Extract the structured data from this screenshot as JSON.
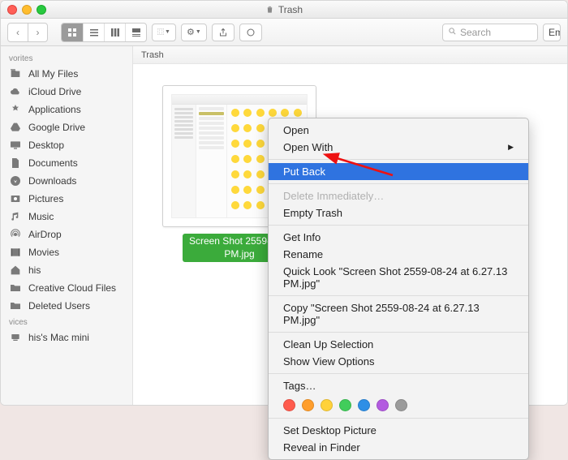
{
  "window": {
    "title": "Trash"
  },
  "toolbar": {
    "nav_back": "‹",
    "nav_fwd": "›",
    "view1": "icon",
    "view2": "list",
    "view3": "column",
    "view4": "coverflow",
    "arrange": "⿲▾",
    "gear": "⚙︎▾",
    "share": "⤴︎",
    "tag": "◯",
    "search_placeholder": "Search",
    "empty": "Empty"
  },
  "sidebar": {
    "sections": [
      {
        "head": "vorites",
        "items": [
          {
            "icon": "all-files",
            "label": "All My Files"
          },
          {
            "icon": "cloud",
            "label": "iCloud Drive"
          },
          {
            "icon": "apps",
            "label": "Applications"
          },
          {
            "icon": "gdrive",
            "label": "Google Drive"
          },
          {
            "icon": "desktop",
            "label": "Desktop"
          },
          {
            "icon": "documents",
            "label": "Documents"
          },
          {
            "icon": "downloads",
            "label": "Downloads"
          },
          {
            "icon": "pictures",
            "label": "Pictures"
          },
          {
            "icon": "music",
            "label": "Music"
          },
          {
            "icon": "airdrop",
            "label": "AirDrop"
          },
          {
            "icon": "movies",
            "label": "Movies"
          },
          {
            "icon": "home",
            "label": "his"
          },
          {
            "icon": "folder",
            "label": "Creative Cloud Files"
          },
          {
            "icon": "folder",
            "label": "Deleted Users"
          }
        ]
      },
      {
        "head": "vices",
        "items": [
          {
            "icon": "mac",
            "label": "his's Mac mini"
          }
        ]
      }
    ]
  },
  "pathbar": {
    "location": "Trash"
  },
  "file": {
    "name_line1": "Screen Shot 2559-08-2",
    "name_line2": "PM.jpg"
  },
  "context_menu": {
    "items": [
      {
        "label": "Open",
        "kind": "item"
      },
      {
        "label": "Open With",
        "kind": "submenu"
      },
      {
        "kind": "sep"
      },
      {
        "label": "Put Back",
        "kind": "item",
        "selected": true
      },
      {
        "kind": "sep"
      },
      {
        "label": "Delete Immediately…",
        "kind": "item",
        "disabled": true
      },
      {
        "label": "Empty Trash",
        "kind": "item"
      },
      {
        "kind": "sep"
      },
      {
        "label": "Get Info",
        "kind": "item"
      },
      {
        "label": "Rename",
        "kind": "item"
      },
      {
        "label": "Quick Look \"Screen Shot 2559-08-24 at 6.27.13 PM.jpg\"",
        "kind": "item"
      },
      {
        "kind": "sep"
      },
      {
        "label": "Copy \"Screen Shot 2559-08-24 at 6.27.13 PM.jpg\"",
        "kind": "item"
      },
      {
        "kind": "sep"
      },
      {
        "label": "Clean Up Selection",
        "kind": "item"
      },
      {
        "label": "Show View Options",
        "kind": "item"
      },
      {
        "kind": "sep"
      },
      {
        "label": "Tags…",
        "kind": "item"
      },
      {
        "kind": "tags",
        "colors": [
          "#ff5b4d",
          "#ff9e2c",
          "#ffd23a",
          "#41cd5b",
          "#2e8fe6",
          "#b35be0",
          "#9b9b9b"
        ]
      },
      {
        "kind": "sep"
      },
      {
        "label": "Set Desktop Picture",
        "kind": "item"
      },
      {
        "label": "Reveal in Finder",
        "kind": "item"
      }
    ]
  }
}
